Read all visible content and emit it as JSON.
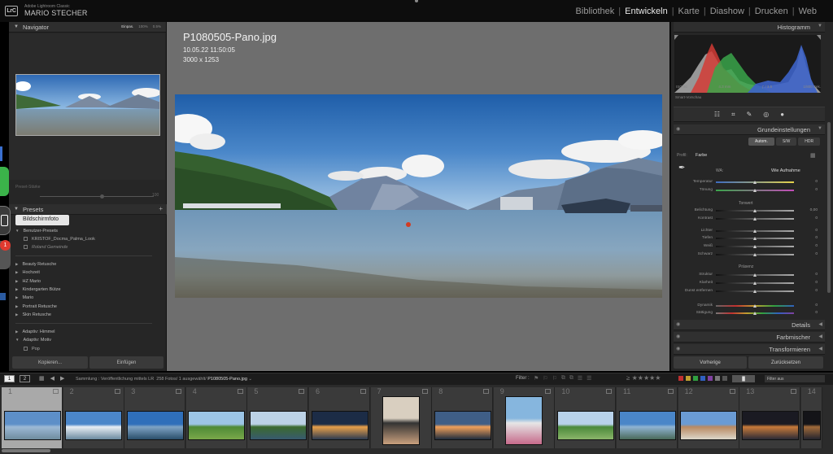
{
  "app": {
    "logo": "LrC",
    "name": "Adobe Lightroom Classic",
    "user": "MARIO STECHER"
  },
  "modules": [
    {
      "label": "Bibliothek",
      "active": false
    },
    {
      "label": "Entwickeln",
      "active": true
    },
    {
      "label": "Karte",
      "active": false
    },
    {
      "label": "Diashow",
      "active": false
    },
    {
      "label": "Drucken",
      "active": false
    },
    {
      "label": "Web",
      "active": false
    }
  ],
  "navigator": {
    "title": "Navigator",
    "zoom": [
      "Einpas.",
      "100%",
      "0.5%"
    ]
  },
  "preset_amount": {
    "label": "Preset-Stärke",
    "value": "100"
  },
  "presets": {
    "title": "Presets",
    "tooltip": "Bildschirmfoto",
    "items": [
      {
        "label": "Benutzer-Presets",
        "type": "group-open"
      },
      {
        "label": "KRISTOF_Docma_Palma_Look",
        "type": "sub"
      },
      {
        "label": "Roland Gemeinde",
        "type": "sub-ital"
      },
      {
        "label": "Beauty Retusche",
        "type": "group"
      },
      {
        "label": "Hochzeit",
        "type": "group"
      },
      {
        "label": "HZ Mario",
        "type": "group"
      },
      {
        "label": "Kindergarten Bütze",
        "type": "group"
      },
      {
        "label": "Mario",
        "type": "group"
      },
      {
        "label": "Portrait Retusche",
        "type": "group"
      },
      {
        "label": "Skin Retusche",
        "type": "group"
      },
      {
        "label": "Adaptiv: Himmel",
        "type": "group"
      },
      {
        "label": "Adaptiv: Motiv",
        "type": "group-open"
      },
      {
        "label": "Pop",
        "type": "sub"
      }
    ]
  },
  "left_buttons": {
    "copy": "Kopieren...",
    "paste": "Einfügen"
  },
  "dock": {
    "badge": "1"
  },
  "photo": {
    "filename": "P1080505-Pano.jpg",
    "date": "10.05.22 11:50:05",
    "dims": "3000 x 1253"
  },
  "histogram": {
    "title": "Histogramm",
    "info": [
      "ISO 80",
      "4.3 mm",
      "ƒ / 3.5",
      "1/800 Sek."
    ],
    "smart_preview": "Smart-Vorschau"
  },
  "basic": {
    "title": "Grundeinstellungen",
    "modes": [
      {
        "label": "Autom.",
        "on": true
      },
      {
        "label": "S/W",
        "on": false
      },
      {
        "label": "HDR",
        "on": false
      }
    ],
    "profile_label": "Profil:",
    "profile_value": "Farbe",
    "wb_label": "WA:",
    "wb_value": "Wie Aufnahme",
    "tone_label": "Tonwert",
    "presence_label": "Präsenz",
    "sliders": [
      {
        "label": "Temperatur",
        "value": "0",
        "pos": 0.5,
        "track": "temp"
      },
      {
        "label": "Tönung",
        "value": "0",
        "pos": 0.5,
        "track": "tint"
      },
      {
        "label": "Belichtung",
        "value": "0,00",
        "pos": 0.5,
        "track": "gray"
      },
      {
        "label": "Kontrast",
        "value": "0",
        "pos": 0.5,
        "track": "gray"
      },
      {
        "label": "Lichter",
        "value": "0",
        "pos": 0.5,
        "track": "gray"
      },
      {
        "label": "Tiefen",
        "value": "0",
        "pos": 0.5,
        "track": "gray"
      },
      {
        "label": "Weiß",
        "value": "0",
        "pos": 0.5,
        "track": "gray"
      },
      {
        "label": "Schwarz",
        "value": "0",
        "pos": 0.5,
        "track": "gray"
      },
      {
        "label": "Struktur",
        "value": "0",
        "pos": 0.5,
        "track": "gray"
      },
      {
        "label": "Klarheit",
        "value": "0",
        "pos": 0.5,
        "track": "gray"
      },
      {
        "label": "Dunst entfernen",
        "value": "0",
        "pos": 0.5,
        "track": "gray"
      },
      {
        "label": "Dynamik",
        "value": "0",
        "pos": 0.5,
        "track": "vib"
      },
      {
        "label": "Sättigung",
        "value": "0",
        "pos": 0.5,
        "track": "sat"
      }
    ]
  },
  "panels": {
    "details": "Details",
    "mixer": "Farbmischer",
    "transform": "Transformieren"
  },
  "right_buttons": {
    "prev": "Vorherige",
    "reset": "Zurücksetzen"
  },
  "filmbar": {
    "monitor1": "1",
    "monitor2": "2",
    "source": "Sammlung : Veröffentlichung mittels LR",
    "count": "258 Fotos/ 1 ausgewählt/",
    "file": "P1080505-Pano.jpg",
    "filter_label": "Filter :",
    "filter_value": "Filter aus"
  },
  "filmstrip": [
    {
      "num": "1",
      "kind": "lake",
      "selected": true
    },
    {
      "num": "2",
      "kind": "harbor"
    },
    {
      "num": "3",
      "kind": "harbor2"
    },
    {
      "num": "4",
      "kind": "meadow"
    },
    {
      "num": "5",
      "kind": "lake2"
    },
    {
      "num": "6",
      "kind": "sunset"
    },
    {
      "num": "7",
      "kind": "portrait"
    },
    {
      "num": "8",
      "kind": "sunset2"
    },
    {
      "num": "9",
      "kind": "portrait2"
    },
    {
      "num": "10",
      "kind": "garden"
    },
    {
      "num": "11",
      "kind": "village"
    },
    {
      "num": "12",
      "kind": "castle"
    },
    {
      "num": "13",
      "kind": "night"
    },
    {
      "num": "14",
      "kind": "night2"
    }
  ]
}
